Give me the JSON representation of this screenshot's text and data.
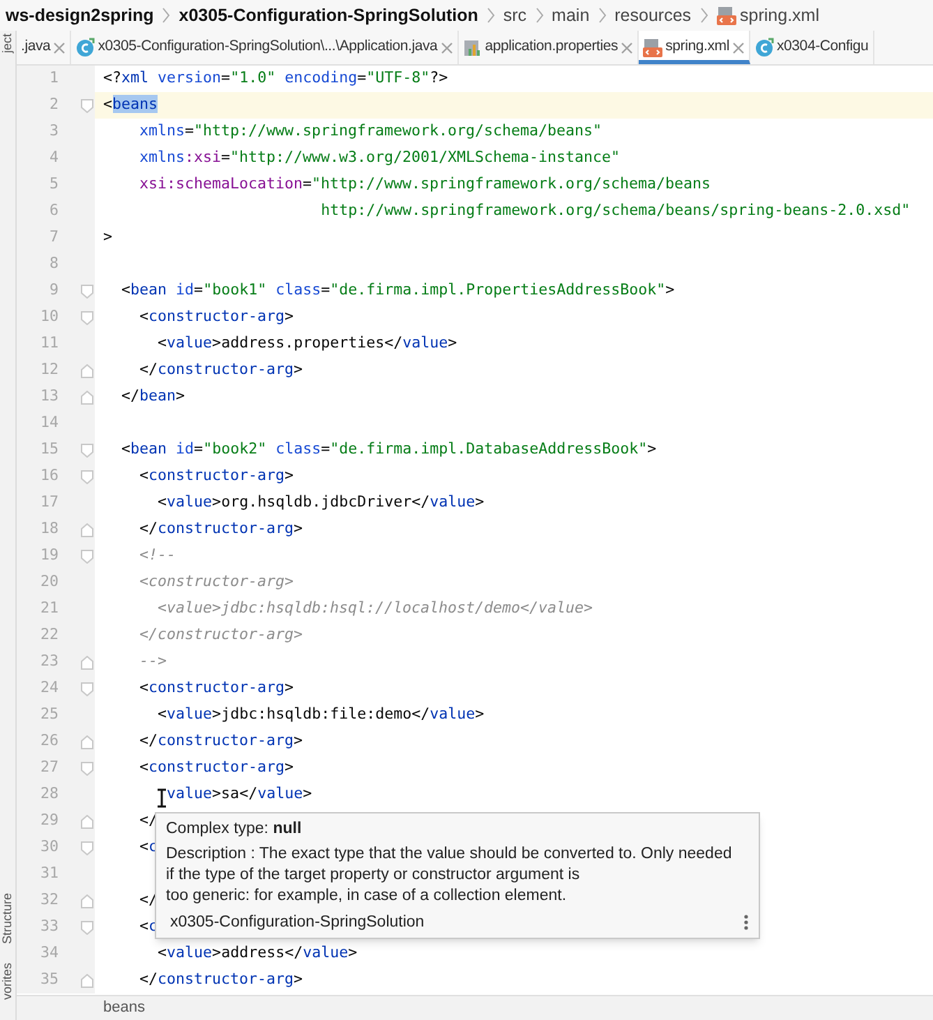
{
  "breadcrumb": [
    {
      "label": "ws-design2spring",
      "kind": "project"
    },
    {
      "label": "x0305-Configuration-SpringSolution",
      "kind": "module"
    },
    {
      "label": "src",
      "kind": "folder"
    },
    {
      "label": "main",
      "kind": "folder"
    },
    {
      "label": "resources",
      "kind": "folder"
    },
    {
      "label": "spring.xml",
      "kind": "file"
    }
  ],
  "side_tools": [
    {
      "label": "ject",
      "kind": "top"
    },
    {
      "label": "Structure",
      "kind": "bottom"
    },
    {
      "label": "vorites",
      "kind": "bottom"
    }
  ],
  "tabs": [
    {
      "label": ".java",
      "kind": "plain",
      "selected": false,
      "close": true
    },
    {
      "label": "x0305-Configuration-SpringSolution\\...\\Application.java",
      "kind": "java",
      "selected": false,
      "close": true
    },
    {
      "label": "application.properties",
      "kind": "properties",
      "selected": false,
      "close": true
    },
    {
      "label": "spring.xml",
      "kind": "xml",
      "selected": true,
      "close": true
    },
    {
      "label": "x0304-Configu",
      "kind": "java",
      "selected": false,
      "close": false
    }
  ],
  "lines": [
    {
      "number": "1",
      "current": false,
      "kind": "plain",
      "tokens": [
        {
          "kind": "punct",
          "t": "<?"
        },
        {
          "kind": "tag",
          "t": "xml"
        },
        {
          "kind": "attr",
          "t": " version"
        },
        {
          "kind": "punct",
          "t": "="
        },
        {
          "kind": "str",
          "t": "\"1.0\""
        },
        {
          "kind": "attr",
          "t": " encoding"
        },
        {
          "kind": "punct",
          "t": "="
        },
        {
          "kind": "str",
          "t": "\"UTF-8\""
        },
        {
          "kind": "punct",
          "t": "?>"
        }
      ]
    },
    {
      "number": "2",
      "current": true,
      "kind": "fold-start",
      "tokens": [
        {
          "kind": "punct",
          "t": "<"
        },
        {
          "kind": "sel",
          "t": "beans"
        }
      ]
    },
    {
      "number": "3",
      "current": false,
      "kind": "plain",
      "tokens": [
        {
          "kind": "attr",
          "t": "    xmlns"
        },
        {
          "kind": "punct",
          "t": "="
        },
        {
          "kind": "str",
          "t": "\"http://www.springframework.org/schema/beans\""
        }
      ]
    },
    {
      "number": "4",
      "current": false,
      "kind": "plain",
      "tokens": [
        {
          "kind": "attr",
          "t": "    xmlns"
        },
        {
          "kind": "ns",
          "t": ":xsi"
        },
        {
          "kind": "punct",
          "t": "="
        },
        {
          "kind": "str",
          "t": "\"http://www.w3.org/2001/XMLSchema-instance\""
        }
      ]
    },
    {
      "number": "5",
      "current": false,
      "kind": "plain",
      "tokens": [
        {
          "kind": "ns",
          "t": "    xsi:schemaLocation"
        },
        {
          "kind": "punct",
          "t": "="
        },
        {
          "kind": "str",
          "t": "\"http://www.springframework.org/schema/beans"
        }
      ]
    },
    {
      "number": "6",
      "current": false,
      "kind": "plain",
      "tokens": [
        {
          "kind": "str",
          "t": "                        http://www.springframework.org/schema/beans/spring-beans-2.0.xsd\""
        }
      ]
    },
    {
      "number": "7",
      "current": false,
      "kind": "plain",
      "tokens": [
        {
          "kind": "punct",
          "t": ">"
        }
      ]
    },
    {
      "number": "8",
      "current": false,
      "kind": "plain"
    },
    {
      "number": "9",
      "current": false,
      "kind": "fold-start",
      "tokens": [
        {
          "kind": "punct",
          "t": "  <"
        },
        {
          "kind": "tag",
          "t": "bean"
        },
        {
          "kind": "attr",
          "t": " id"
        },
        {
          "kind": "punct",
          "t": "="
        },
        {
          "kind": "str",
          "t": "\"book1\""
        },
        {
          "kind": "attr",
          "t": " class"
        },
        {
          "kind": "punct",
          "t": "="
        },
        {
          "kind": "str",
          "t": "\"de.firma.impl.PropertiesAddressBook\""
        },
        {
          "kind": "punct",
          "t": ">"
        }
      ]
    },
    {
      "number": "10",
      "current": false,
      "kind": "fold-start",
      "tokens": [
        {
          "kind": "punct",
          "t": "    <"
        },
        {
          "kind": "tag",
          "t": "constructor-arg"
        },
        {
          "kind": "punct",
          "t": ">"
        }
      ]
    },
    {
      "number": "11",
      "current": false,
      "kind": "plain",
      "tokens": [
        {
          "kind": "punct",
          "t": "      <"
        },
        {
          "kind": "tag",
          "t": "value"
        },
        {
          "kind": "punct",
          "t": ">"
        },
        {
          "kind": "text",
          "t": "address.properties"
        },
        {
          "kind": "punct",
          "t": "</"
        },
        {
          "kind": "tag",
          "t": "value"
        },
        {
          "kind": "punct",
          "t": ">"
        }
      ]
    },
    {
      "number": "12",
      "current": false,
      "kind": "fold-end",
      "tokens": [
        {
          "kind": "punct",
          "t": "    </"
        },
        {
          "kind": "tag",
          "t": "constructor-arg"
        },
        {
          "kind": "punct",
          "t": ">"
        }
      ]
    },
    {
      "number": "13",
      "current": false,
      "kind": "fold-end",
      "tokens": [
        {
          "kind": "punct",
          "t": "  </"
        },
        {
          "kind": "tag",
          "t": "bean"
        },
        {
          "kind": "punct",
          "t": ">"
        }
      ]
    },
    {
      "number": "14",
      "current": false,
      "kind": "plain"
    },
    {
      "number": "15",
      "current": false,
      "kind": "fold-start",
      "tokens": [
        {
          "kind": "punct",
          "t": "  <"
        },
        {
          "kind": "tag",
          "t": "bean"
        },
        {
          "kind": "attr",
          "t": " id"
        },
        {
          "kind": "punct",
          "t": "="
        },
        {
          "kind": "str",
          "t": "\"book2\""
        },
        {
          "kind": "attr",
          "t": " class"
        },
        {
          "kind": "punct",
          "t": "="
        },
        {
          "kind": "str",
          "t": "\"de.firma.impl.DatabaseAddressBook\""
        },
        {
          "kind": "punct",
          "t": ">"
        }
      ]
    },
    {
      "number": "16",
      "current": false,
      "kind": "fold-start",
      "tokens": [
        {
          "kind": "punct",
          "t": "    <"
        },
        {
          "kind": "tag",
          "t": "constructor-arg"
        },
        {
          "kind": "punct",
          "t": ">"
        }
      ]
    },
    {
      "number": "17",
      "current": false,
      "kind": "plain",
      "tokens": [
        {
          "kind": "punct",
          "t": "      <"
        },
        {
          "kind": "tag",
          "t": "value"
        },
        {
          "kind": "punct",
          "t": ">"
        },
        {
          "kind": "text",
          "t": "org.hsqldb.jdbcDriver"
        },
        {
          "kind": "punct",
          "t": "</"
        },
        {
          "kind": "tag",
          "t": "value"
        },
        {
          "kind": "punct",
          "t": ">"
        }
      ]
    },
    {
      "number": "18",
      "current": false,
      "kind": "fold-end",
      "tokens": [
        {
          "kind": "punct",
          "t": "    </"
        },
        {
          "kind": "tag",
          "t": "constructor-arg"
        },
        {
          "kind": "punct",
          "t": ">"
        }
      ]
    },
    {
      "number": "19",
      "current": false,
      "kind": "fold-start",
      "tokens": [
        {
          "kind": "comment",
          "t": "    <!--"
        }
      ]
    },
    {
      "number": "20",
      "current": false,
      "kind": "plain",
      "tokens": [
        {
          "kind": "comment",
          "t": "    <constructor-arg>"
        }
      ]
    },
    {
      "number": "21",
      "current": false,
      "kind": "plain",
      "tokens": [
        {
          "kind": "comment",
          "t": "      <value>jdbc:hsqldb:hsql://localhost/demo</value>"
        }
      ]
    },
    {
      "number": "22",
      "current": false,
      "kind": "plain",
      "tokens": [
        {
          "kind": "comment",
          "t": "    </constructor-arg>"
        }
      ]
    },
    {
      "number": "23",
      "current": false,
      "kind": "fold-end",
      "tokens": [
        {
          "kind": "comment",
          "t": "    -->"
        }
      ]
    },
    {
      "number": "24",
      "current": false,
      "kind": "fold-start",
      "tokens": [
        {
          "kind": "punct",
          "t": "    <"
        },
        {
          "kind": "tag",
          "t": "constructor-arg"
        },
        {
          "kind": "punct",
          "t": ">"
        }
      ]
    },
    {
      "number": "25",
      "current": false,
      "kind": "plain",
      "tokens": [
        {
          "kind": "punct",
          "t": "      <"
        },
        {
          "kind": "tag",
          "t": "value"
        },
        {
          "kind": "punct",
          "t": ">"
        },
        {
          "kind": "text",
          "t": "jdbc:hsqldb:file:demo"
        },
        {
          "kind": "punct",
          "t": "</"
        },
        {
          "kind": "tag",
          "t": "value"
        },
        {
          "kind": "punct",
          "t": ">"
        }
      ]
    },
    {
      "number": "26",
      "current": false,
      "kind": "fold-end",
      "tokens": [
        {
          "kind": "punct",
          "t": "    </"
        },
        {
          "kind": "tag",
          "t": "constructor-arg"
        },
        {
          "kind": "punct",
          "t": ">"
        }
      ]
    },
    {
      "number": "27",
      "current": false,
      "kind": "fold-start",
      "tokens": [
        {
          "kind": "punct",
          "t": "    <"
        },
        {
          "kind": "tag",
          "t": "constructor-arg"
        },
        {
          "kind": "punct",
          "t": ">"
        }
      ]
    },
    {
      "number": "28",
      "current": false,
      "kind": "plain",
      "tokens": [
        {
          "kind": "tag",
          "t": "       value"
        },
        {
          "kind": "punct",
          "t": ">"
        },
        {
          "kind": "text",
          "t": "sa"
        },
        {
          "kind": "punct",
          "t": "</"
        },
        {
          "kind": "tag",
          "t": "value"
        },
        {
          "kind": "punct",
          "t": ">"
        }
      ]
    },
    {
      "number": "29",
      "current": false,
      "kind": "fold-end",
      "tokens": [
        {
          "kind": "punct",
          "t": "    </"
        }
      ]
    },
    {
      "number": "30",
      "current": false,
      "kind": "fold-start",
      "tokens": [
        {
          "kind": "punct",
          "t": "    <"
        },
        {
          "kind": "tag",
          "t": "c"
        }
      ]
    },
    {
      "number": "31",
      "current": false,
      "kind": "plain"
    },
    {
      "number": "32",
      "current": false,
      "kind": "fold-end",
      "tokens": [
        {
          "kind": "punct",
          "t": "    </"
        }
      ]
    },
    {
      "number": "33",
      "current": false,
      "kind": "fold-start",
      "tokens": [
        {
          "kind": "punct",
          "t": "    <"
        },
        {
          "kind": "tag",
          "t": "c"
        }
      ]
    },
    {
      "number": "34",
      "current": false,
      "kind": "plain",
      "tokens": [
        {
          "kind": "punct",
          "t": "      <"
        },
        {
          "kind": "tag",
          "t": "value"
        },
        {
          "kind": "punct",
          "t": ">"
        },
        {
          "kind": "text",
          "t": "address"
        },
        {
          "kind": "punct",
          "t": "</"
        },
        {
          "kind": "tag",
          "t": "value"
        },
        {
          "kind": "punct",
          "t": ">"
        }
      ]
    },
    {
      "number": "35",
      "current": false,
      "kind": "fold-end",
      "tokens": [
        {
          "kind": "punct",
          "t": "    </"
        },
        {
          "kind": "tag",
          "t": "constructor-arg"
        },
        {
          "kind": "punct",
          "t": ">"
        }
      ]
    }
  ],
  "tooltip": {
    "title": "Complex type: **null**",
    "description": [
      "Description : The exact type that the value should be converted to. Only needed",
      "if the type of the target property or constructor argument is",
      "too generic: for example, in case of a collection element."
    ],
    "footer": "x0305-Configuration-SpringSolution"
  },
  "status_bar": {
    "path": "beans"
  }
}
